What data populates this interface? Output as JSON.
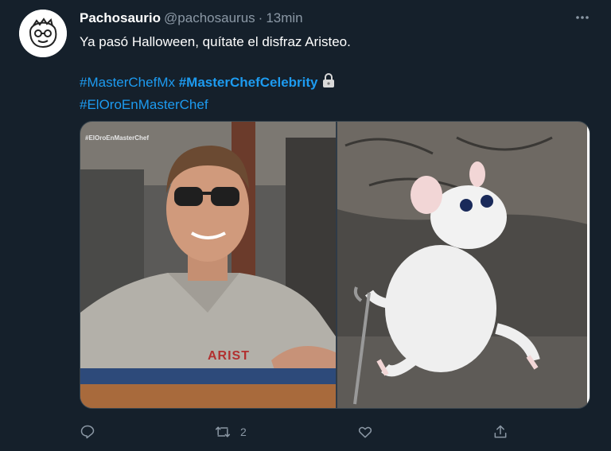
{
  "tweet": {
    "display_name": "Pachosaurio",
    "handle": "@pachosaurus",
    "separator": "·",
    "time": "13min",
    "text": "Ya pasó Halloween, quítate el disfraz Aristeo.",
    "hashtags": [
      "#MasterChefMx",
      "#MasterChefCelebrity",
      "#ElOroEnMasterChef"
    ],
    "media": {
      "left_watermark": "#ElOroEnMasterChef",
      "left_shirt_text": "ARIST"
    },
    "actions": {
      "reply_count": "",
      "retweet_count": "2",
      "like_count": ""
    }
  },
  "icons": [
    "avatar-sketch-icon",
    "more-icon",
    "padlock-icon",
    "reply-icon",
    "retweet-icon",
    "like-icon",
    "share-icon"
  ],
  "colors": {
    "background": "#15202b",
    "link": "#1d9bf0",
    "muted": "#8b98a5"
  }
}
